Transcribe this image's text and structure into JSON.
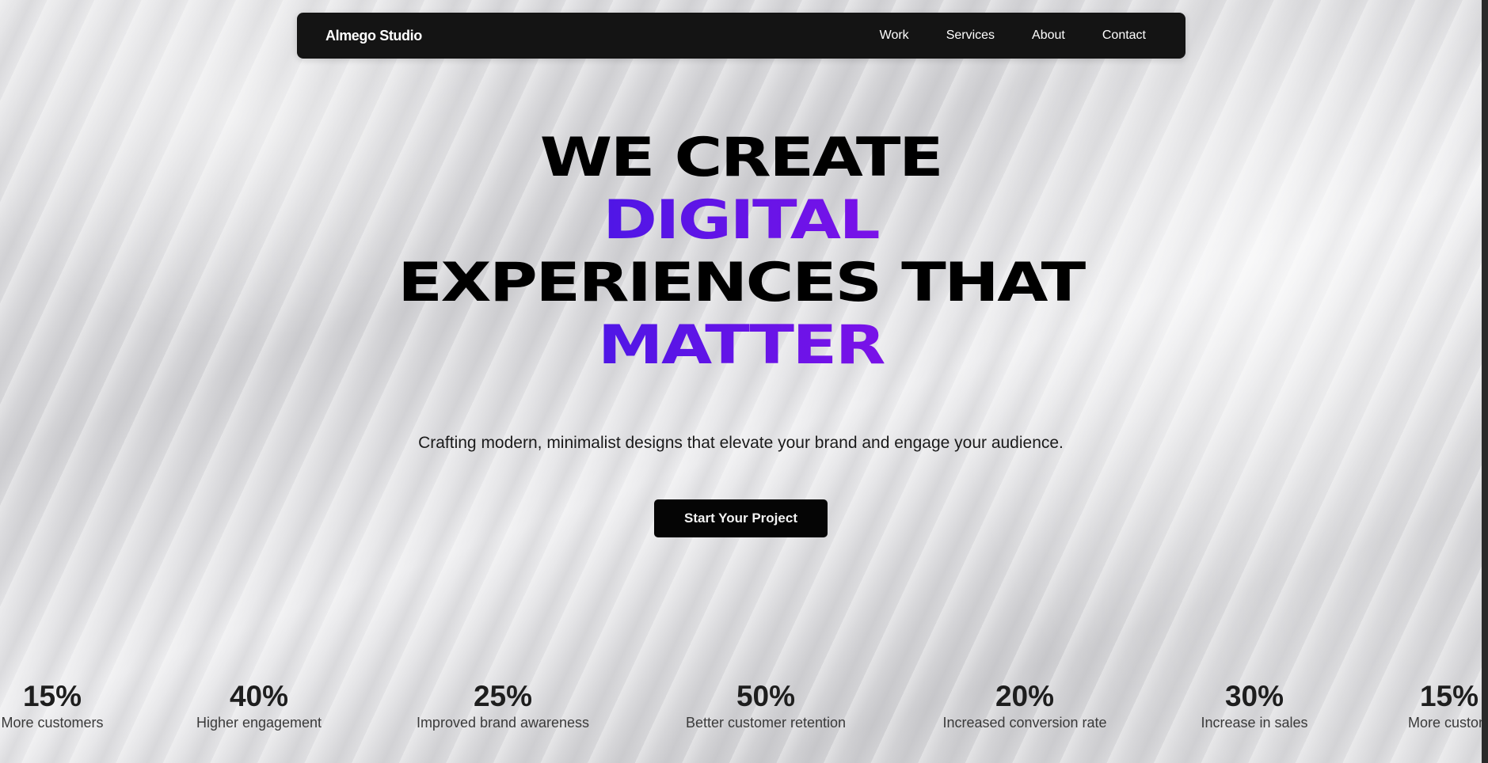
{
  "nav": {
    "brand": "Almego Studio",
    "links": [
      "Work",
      "Services",
      "About",
      "Contact"
    ]
  },
  "hero": {
    "line1": "WE CREATE",
    "line2": "DIGITAL",
    "line3": "EXPERIENCES THAT",
    "line4": "MATTER",
    "subtitle": "Crafting modern, minimalist designs that elevate your brand and engage your audience.",
    "cta_label": "Start Your Project"
  },
  "stats": [
    {
      "value": "15%",
      "label": "More customers"
    },
    {
      "value": "40%",
      "label": "Higher engagement"
    },
    {
      "value": "25%",
      "label": "Improved brand awareness"
    },
    {
      "value": "50%",
      "label": "Better customer retention"
    },
    {
      "value": "20%",
      "label": "Increased conversion rate"
    },
    {
      "value": "30%",
      "label": "Increase in sales"
    },
    {
      "value": "15%",
      "label": "More custom"
    }
  ],
  "colors": {
    "accent_start": "#4f16e6",
    "accent_end": "#7a12e8",
    "nav_bg": "#141414",
    "cta_bg": "#050505"
  }
}
